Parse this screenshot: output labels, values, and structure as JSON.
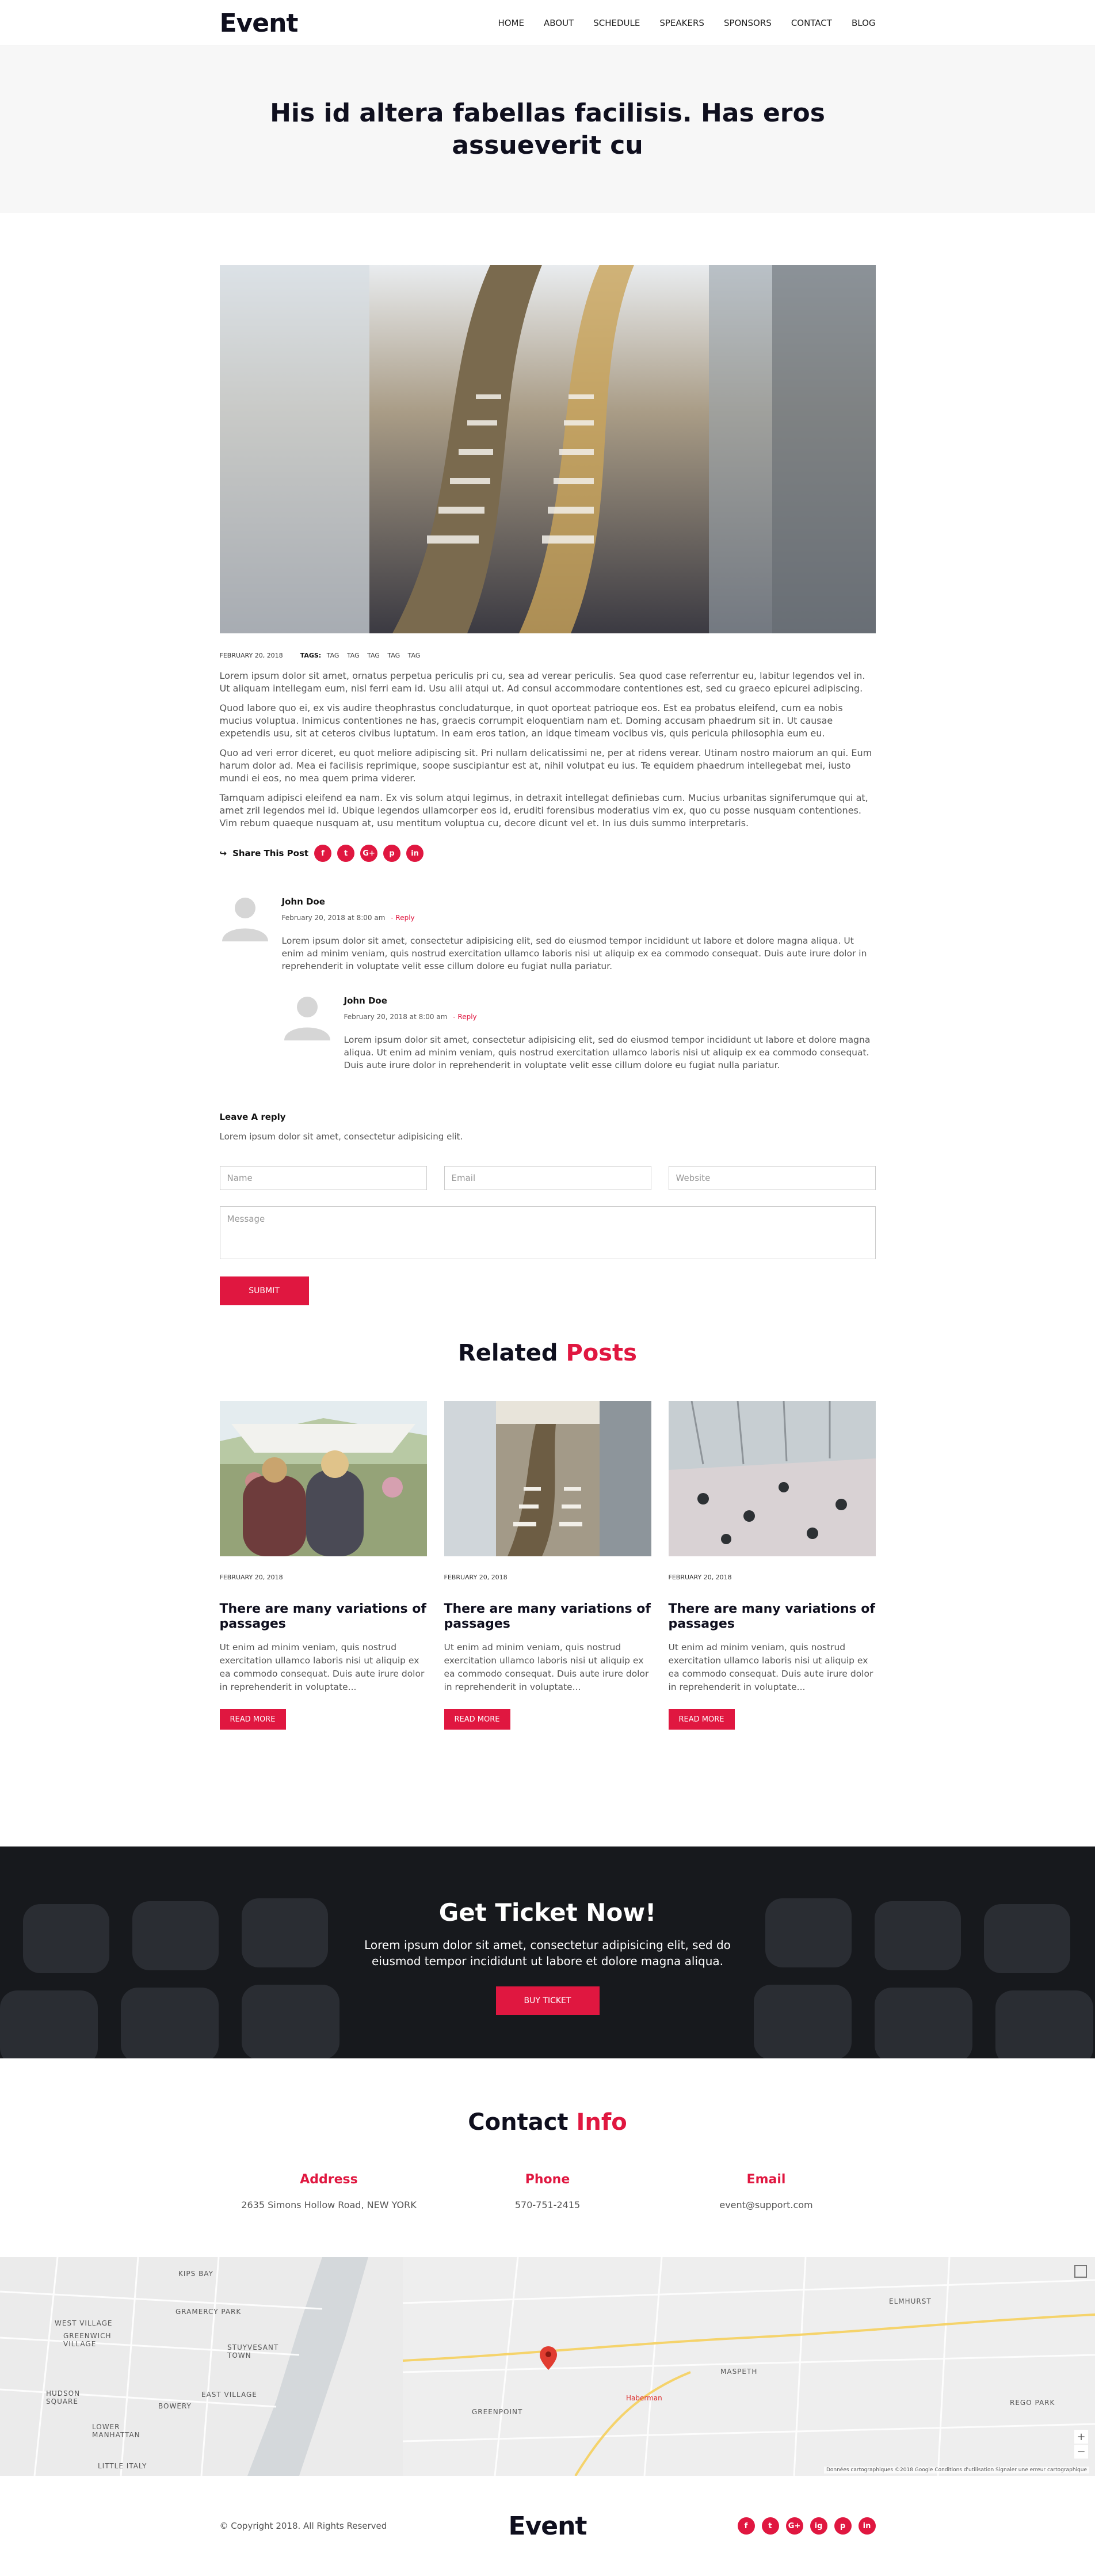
{
  "header": {
    "logo": "Event",
    "nav": [
      "HOME",
      "ABOUT",
      "SCHEDULE",
      "SPEAKERS",
      "SPONSORS",
      "CONTACT",
      "BLOG"
    ]
  },
  "page": {
    "title": "His id altera fabellas facilisis. Has eros assueverit cu"
  },
  "post": {
    "date": "FEBRUARY 20, 2018",
    "tags_label": "TAGS:",
    "tags": [
      "TAG",
      "TAG",
      "TAG",
      "TAG",
      "TAG"
    ],
    "paragraphs": [
      "Lorem ipsum dolor sit amet, ornatus perpetua periculis pri cu, sea ad verear periculis. Sea quod case referrentur eu, labitur legendos vel in. Ut aliquam intellegam eum, nisl ferri eam id. Usu alii atqui ut. Ad consul accommodare contentiones est, sed cu graeco epicurei adipiscing.",
      "Quod labore quo ei, ex vis audire theophrastus concludaturque, in quot oporteat patrioque eos. Est ea probatus eleifend, cum ea nobis mucius voluptua. Inimicus contentiones ne has, graecis corrumpit eloquentiam nam et. Doming accusam phaedrum sit in. Ut causae expetendis usu, sit at ceteros civibus luptatum. In eam eros tation, an idque timeam vocibus vis, quis pericula philosophia eum eu.",
      "Quo ad veri error diceret, eu quot meliore adipiscing sit. Pri nullam delicatissimi ne, per at ridens verear. Utinam nostro maiorum an qui. Eum harum dolor ad. Mea ei facilisis reprimique, soope suscipiantur est at, nihil volutpat eu ius. Te equidem phaedrum intellegebat mei, iusto mundi ei eos, no mea quem prima viderer.",
      "Tamquam adipisci eleifend ea nam. Ex vis solum atqui legimus, in detraxit intellegat definiebas cum. Mucius urbanitas signiferumque qui at, amet zril legendos mei id. Ubique legendos ullamcorper eos id, eruditi forensibus moderatius vim ex, quo cu posse nusquam contentiones. Vim rebum quaeque nusquam at, usu mentitum voluptua cu, decore dicunt vel et. In ius duis summo interpretaris."
    ],
    "share_label": "Share This Post",
    "share_icons": [
      "f",
      "t",
      "G+",
      "p",
      "in"
    ]
  },
  "comments": [
    {
      "name": "John Doe",
      "date": "February 20, 2018 at 8:00 am",
      "reply": "- Reply",
      "text": "Lorem ipsum dolor sit amet, consectetur adipisicing elit, sed do eiusmod tempor incididunt ut labore et dolore magna aliqua. Ut enim ad minim veniam, quis nostrud exercitation ullamco laboris nisi ut aliquip ex ea commodo consequat. Duis aute irure dolor in reprehenderit in voluptate velit esse cillum dolore eu fugiat nulla pariatur."
    },
    {
      "name": "John Doe",
      "date": "February 20, 2018 at 8:00 am",
      "reply": "- Reply",
      "text": "Lorem ipsum dolor sit amet, consectetur adipisicing elit, sed do eiusmod tempor incididunt ut labore et dolore magna aliqua. Ut enim ad minim veniam, quis nostrud exercitation ullamco laboris nisi ut aliquip ex ea commodo consequat. Duis aute irure dolor in reprehenderit in voluptate velit esse cillum dolore eu fugiat nulla pariatur."
    }
  ],
  "reply_form": {
    "title": "Leave A reply",
    "subtitle": "Lorem ipsum dolor sit amet, consectetur adipisicing elit.",
    "name_placeholder": "Name",
    "email_placeholder": "Email",
    "website_placeholder": "Website",
    "message_placeholder": "Message",
    "submit": "SUBMIT"
  },
  "related": {
    "title_main": "Related",
    "title_accent": "Posts",
    "posts": [
      {
        "date": "FEBRUARY 20, 2018",
        "title": "There are many variations of passages",
        "text": "Ut enim ad minim veniam, quis nostrud exercitation ullamco laboris nisi ut aliquip ex ea commodo consequat. Duis aute irure dolor in reprehenderit in voluptate...",
        "button": "READ MORE"
      },
      {
        "date": "FEBRUARY 20, 2018",
        "title": "There are many variations of passages",
        "text": "Ut enim ad minim veniam, quis nostrud exercitation ullamco laboris nisi ut aliquip ex ea commodo consequat. Duis aute irure dolor in reprehenderit in voluptate...",
        "button": "READ MORE"
      },
      {
        "date": "FEBRUARY 20, 2018",
        "title": "There are many variations of passages",
        "text": "Ut enim ad minim veniam, quis nostrud exercitation ullamco laboris nisi ut aliquip ex ea commodo consequat. Duis aute irure dolor in reprehenderit in voluptate...",
        "button": "READ MORE"
      }
    ]
  },
  "ticket": {
    "title": "Get Ticket Now!",
    "text": "Lorem ipsum dolor sit amet, consectetur adipisicing elit, sed do eiusmod tempor incididunt ut labore et dolore magna aliqua.",
    "button": "BUY TICKET"
  },
  "contact": {
    "title_main": "Contact",
    "title_accent": "Info",
    "address_label": "Address",
    "address": "2635 Simons Hollow Road, NEW YORK",
    "phone_label": "Phone",
    "phone": "570-751-2415",
    "email_label": "Email",
    "email": "event@support.com"
  },
  "map": {
    "labels": [
      "KIPS BAY",
      "WEST VILLAGE",
      "GREENWICH VILLAGE",
      "GRAMERCY PARK",
      "STUYVESANT TOWN",
      "HUDSON SQUARE",
      "EAST VILLAGE",
      "BOWERY",
      "LOWER MANHATTAN",
      "LITTLE ITALY",
      "GREENPOINT",
      "Haberman",
      "MASPETH",
      "ELMHURST",
      "REGO PARK"
    ],
    "attribution": "Données cartographiques ©2018 Google   Conditions d'utilisation   Signaler une erreur cartographique"
  },
  "footer": {
    "copyright": "© Copyright 2018. All Rights Reserved",
    "logo": "Event",
    "socials": [
      "f",
      "t",
      "G+",
      "ig",
      "p",
      "in"
    ]
  },
  "colors": {
    "accent": "#e01740",
    "dark": "#0f0f1e"
  }
}
